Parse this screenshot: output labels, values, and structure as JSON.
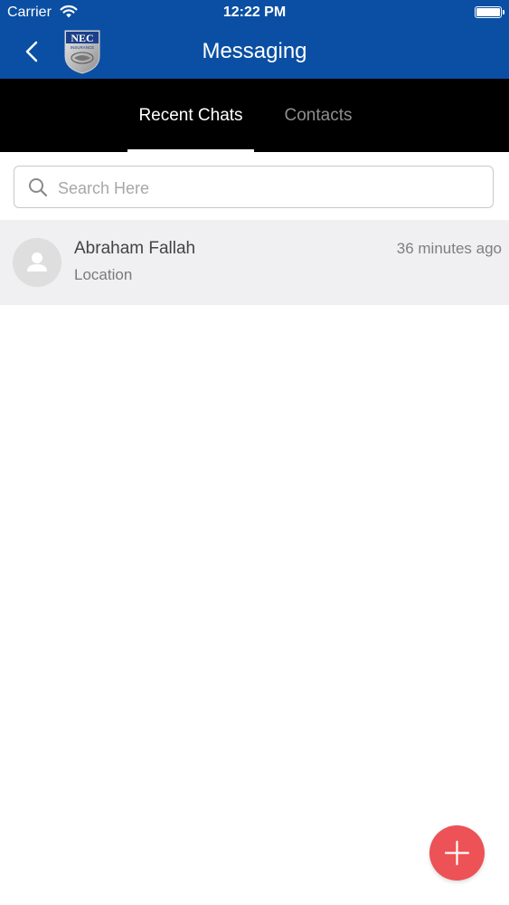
{
  "colors": {
    "header_bg": "#0a4fa3",
    "tabbar_bg": "#000000",
    "active_tab": "#ffffff",
    "inactive_tab": "#8e8e8e",
    "chat_row_bg": "#f0eff1",
    "fab": "#ec5256"
  },
  "status_bar": {
    "carrier": "Carrier",
    "time": "12:22 PM",
    "icons": [
      "wifi-icon",
      "battery-icon"
    ]
  },
  "header": {
    "title": "Messaging",
    "back_icon": "chevron-left-icon",
    "logo_text": "NEC",
    "logo_subtext": "INSURANCE"
  },
  "tabs": [
    {
      "label": "Recent Chats",
      "active": true
    },
    {
      "label": "Contacts",
      "active": false
    }
  ],
  "search": {
    "placeholder": "Search Here",
    "value": "",
    "icon": "search-icon"
  },
  "chats": [
    {
      "name": "Abraham Fallah",
      "preview": "Location",
      "time": "36 minutes ago",
      "avatar_icon": "person-icon"
    }
  ],
  "fab": {
    "icon": "plus-icon"
  }
}
